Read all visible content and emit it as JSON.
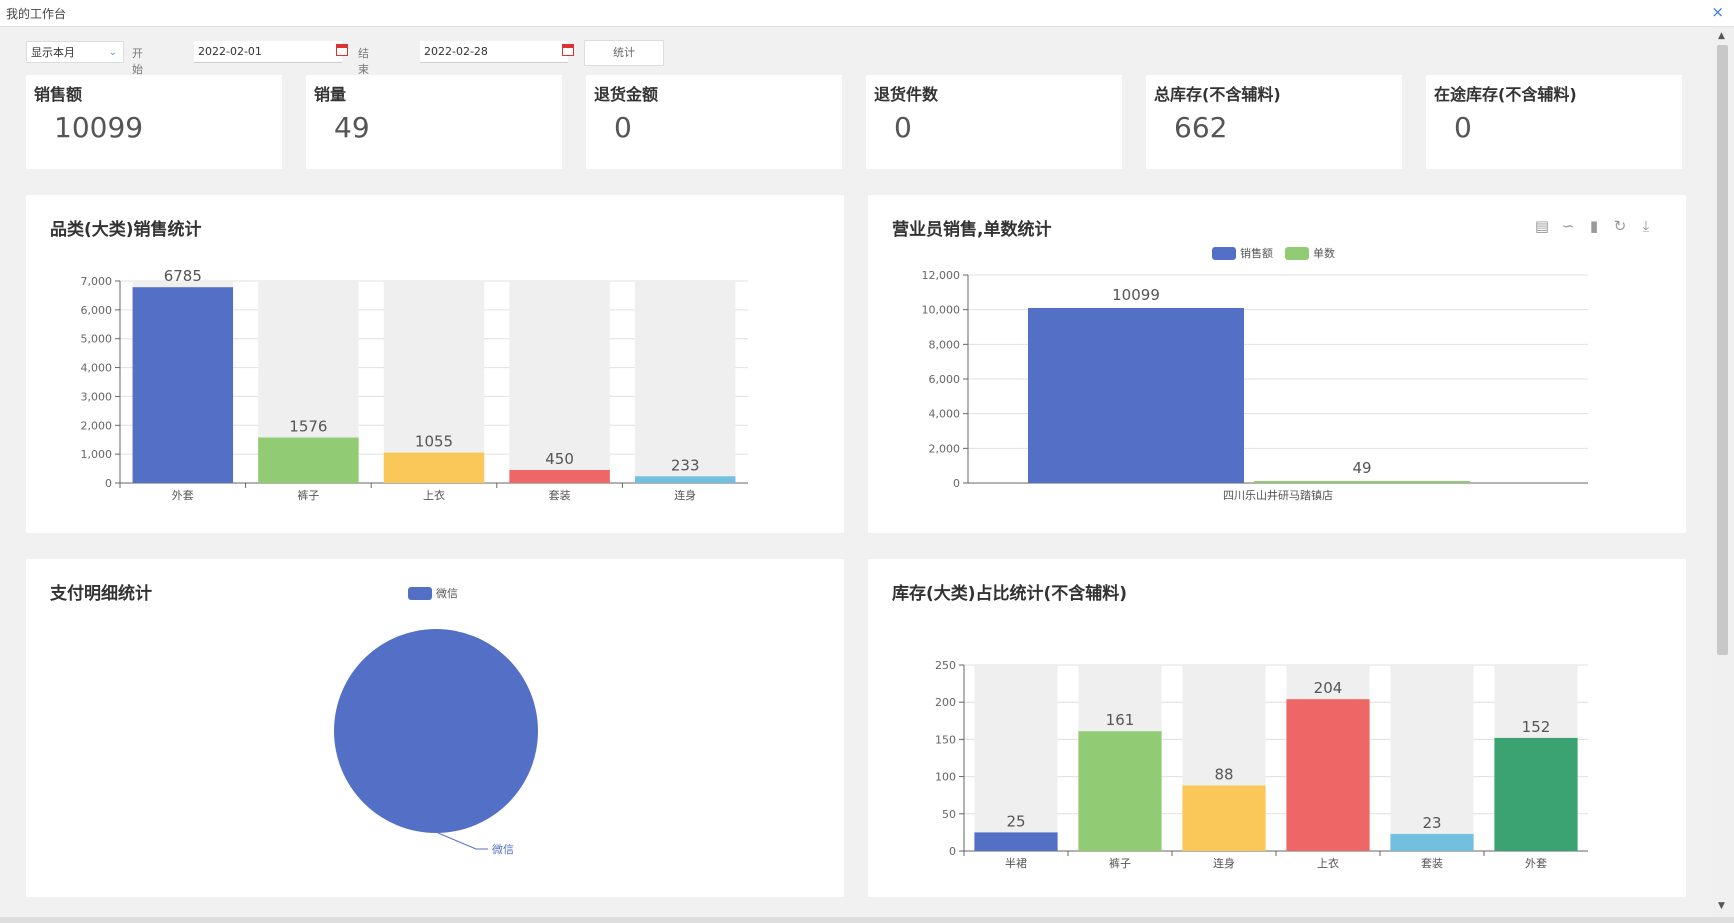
{
  "window": {
    "title": "我的工作台",
    "close": "×"
  },
  "filter": {
    "range": "显示本月",
    "start_label": "开始时间:",
    "start": "2022-02-01",
    "end_label": "结束时间:",
    "end": "2022-02-28",
    "button": "统计"
  },
  "kpis": [
    {
      "label": "销售额",
      "value": "10099"
    },
    {
      "label": "销量",
      "value": "49"
    },
    {
      "label": "退货金额",
      "value": "0"
    },
    {
      "label": "退货件数",
      "value": "0"
    },
    {
      "label": "总库存(不含辅料)",
      "value": "662"
    },
    {
      "label": "在途库存(不含辅料)",
      "value": "0"
    }
  ],
  "panels": {
    "category": {
      "title": "品类(大类)销售统计"
    },
    "salesman": {
      "title": "营业员销售,单数统计",
      "legend": [
        "销售额",
        "单数"
      ]
    },
    "payment": {
      "title": "支付明细统计",
      "legend": [
        "微信"
      ]
    },
    "stock": {
      "title": "库存(大类)占比统计(不含辅料)"
    }
  },
  "colors": {
    "blue": "#5470c6",
    "green": "#91cc75",
    "yellow": "#fac858",
    "red": "#ee6666",
    "cyan": "#73c0de",
    "teal": "#3ba272"
  },
  "chart_data": [
    {
      "type": "bar",
      "title": "品类(大类)销售统计",
      "categories": [
        "外套",
        "裤子",
        "上衣",
        "套装",
        "连身"
      ],
      "values": [
        6785,
        1576,
        1055,
        450,
        233
      ],
      "ylim": [
        0,
        7000
      ],
      "yticks": [
        "0",
        "1,000",
        "2,000",
        "3,000",
        "4,000",
        "5,000",
        "6,000",
        "7,000"
      ],
      "colors": [
        "#5470c6",
        "#91cc75",
        "#fac858",
        "#ee6666",
        "#73c0de"
      ]
    },
    {
      "type": "bar",
      "title": "营业员销售,单数统计",
      "categories": [
        "四川乐山井研马踏镇店"
      ],
      "series": [
        {
          "name": "销售额",
          "values": [
            10099
          ]
        },
        {
          "name": "单数",
          "values": [
            49
          ]
        }
      ],
      "ylim": [
        0,
        12000
      ],
      "yticks": [
        "0",
        "2,000",
        "4,000",
        "6,000",
        "8,000",
        "10,000",
        "12,000"
      ],
      "legend": "top-center"
    },
    {
      "type": "pie",
      "title": "支付明细统计",
      "labels": [
        "微信"
      ],
      "values": [
        100
      ],
      "legend": "top-center"
    },
    {
      "type": "bar",
      "title": "库存(大类)占比统计(不含辅料)",
      "categories": [
        "半裙",
        "裤子",
        "连身",
        "上衣",
        "套装",
        "外套"
      ],
      "values": [
        25,
        161,
        88,
        204,
        23,
        152
      ],
      "ylim": [
        0,
        250
      ],
      "yticks": [
        "0",
        "50",
        "100",
        "150",
        "200",
        "250"
      ],
      "colors": [
        "#5470c6",
        "#91cc75",
        "#fac858",
        "#ee6666",
        "#73c0de",
        "#3ba272"
      ]
    }
  ]
}
